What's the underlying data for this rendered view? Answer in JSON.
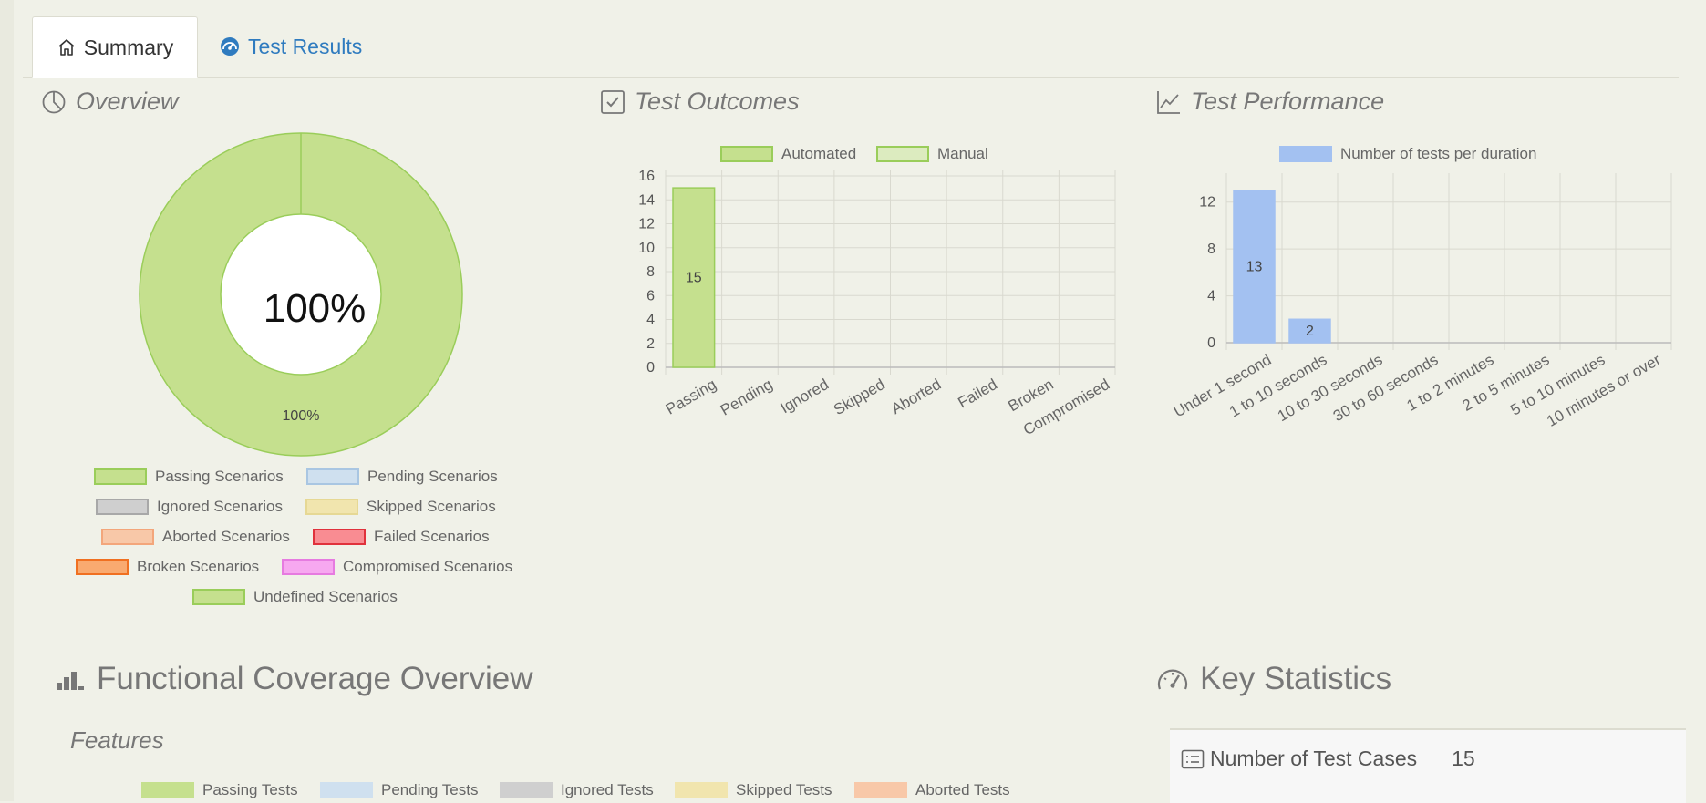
{
  "tabs": [
    {
      "label": "Summary",
      "icon": "home-icon",
      "active": true
    },
    {
      "label": "Test Results",
      "icon": "dashboard-icon",
      "active": false
    }
  ],
  "overview": {
    "title": "Overview",
    "center_label": "100%",
    "slice_label": "100%",
    "legend": [
      {
        "label": "Passing Scenarios",
        "fill": "#c5e08e",
        "stroke": "#9acd5a"
      },
      {
        "label": "Pending Scenarios",
        "fill": "#cfe0ef",
        "stroke": "#a9c6e2"
      },
      {
        "label": "Ignored Scenarios",
        "fill": "#cfcfcf",
        "stroke": "#a8a8a8"
      },
      {
        "label": "Skipped Scenarios",
        "fill": "#f1e5ae",
        "stroke": "#e6d894"
      },
      {
        "label": "Aborted Scenarios",
        "fill": "#f8c8a8",
        "stroke": "#f3a67b"
      },
      {
        "label": "Failed Scenarios",
        "fill": "#f98c92",
        "stroke": "#e0323c"
      },
      {
        "label": "Broken Scenarios",
        "fill": "#f9aa70",
        "stroke": "#f07021"
      },
      {
        "label": "Compromised Scenarios",
        "fill": "#f7a8f0",
        "stroke": "#e67be0"
      },
      {
        "label": "Undefined Scenarios",
        "fill": "#c5e08e",
        "stroke": "#9acd5a"
      }
    ]
  },
  "outcomes": {
    "title": "Test Outcomes",
    "legend": [
      {
        "label": "Automated",
        "fill": "#c5e08e",
        "stroke": "#9acd5a"
      },
      {
        "label": "Manual",
        "fill": "#dcebbf",
        "stroke": "#9acd5a"
      }
    ]
  },
  "performance": {
    "title": "Test Performance",
    "legend": [
      {
        "label": "Number of tests per duration",
        "fill": "#a3c1f1",
        "stroke": "#a3c1f1"
      }
    ]
  },
  "chart_data": [
    {
      "type": "pie",
      "categories": [
        "Passing Scenarios"
      ],
      "values": [
        100
      ],
      "title": ""
    },
    {
      "type": "bar",
      "categories": [
        "Passing",
        "Pending",
        "Ignored",
        "Skipped",
        "Aborted",
        "Failed",
        "Broken",
        "Compromised"
      ],
      "series": [
        {
          "name": "Automated",
          "values": [
            15,
            0,
            0,
            0,
            0,
            0,
            0,
            0
          ]
        },
        {
          "name": "Manual",
          "values": [
            0,
            0,
            0,
            0,
            0,
            0,
            0,
            0
          ]
        }
      ],
      "yticks": [
        "0",
        "2",
        "4",
        "6",
        "8",
        "10",
        "12",
        "14",
        "16"
      ],
      "ylim": [
        0,
        16
      ],
      "grid": true,
      "legend": "top"
    },
    {
      "type": "bar",
      "categories": [
        "Under 1 second",
        "1 to 10 seconds",
        "10 to 30 seconds",
        "30 to 60 seconds",
        "1 to 2 minutes",
        "2 to 5 minutes",
        "5 to 10 minutes",
        "10 minutes or over"
      ],
      "series": [
        {
          "name": "Number of tests per duration",
          "values": [
            13,
            2,
            0,
            0,
            0,
            0,
            0,
            0
          ]
        }
      ],
      "yticks": [
        "0",
        "4",
        "8",
        "12"
      ],
      "ylim": [
        0,
        14
      ],
      "grid": true,
      "legend": "top"
    }
  ],
  "coverage": {
    "title": "Functional Coverage Overview",
    "features_label": "Features",
    "legend": [
      {
        "label": "Passing Tests",
        "fill": "#c5e08e",
        "stroke": "#c5e08e"
      },
      {
        "label": "Pending Tests",
        "fill": "#cfe0ef",
        "stroke": "#cfe0ef"
      },
      {
        "label": "Ignored Tests",
        "fill": "#cfcfcf",
        "stroke": "#cfcfcf"
      },
      {
        "label": "Skipped Tests",
        "fill": "#f1e5ae",
        "stroke": "#f1e5ae"
      },
      {
        "label": "Aborted Tests",
        "fill": "#f8c8a8",
        "stroke": "#f8c8a8"
      }
    ]
  },
  "stats": {
    "title": "Key Statistics",
    "rows": [
      {
        "label": "Number of Test Cases",
        "value": "15"
      }
    ]
  }
}
